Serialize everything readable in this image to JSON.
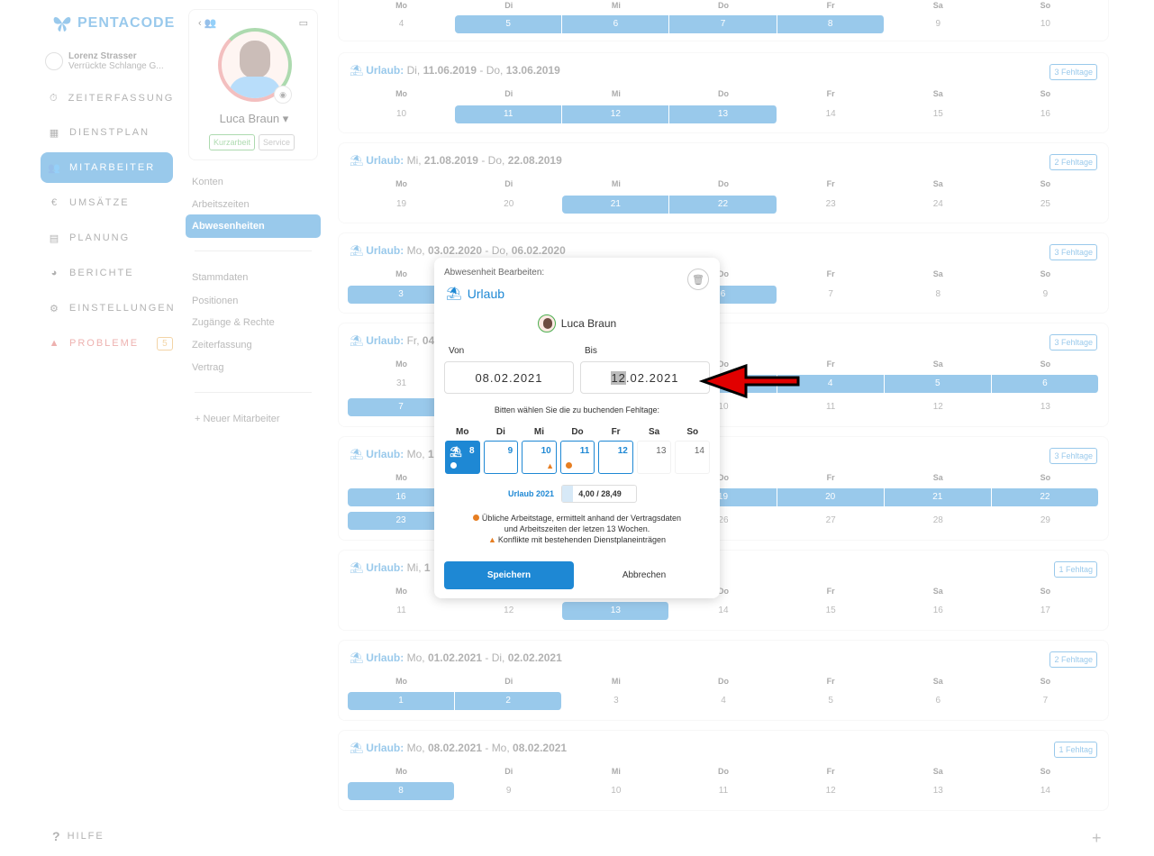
{
  "app": {
    "logo": "PENTACODE"
  },
  "user": {
    "name": "Lorenz Strasser",
    "company": "Verrückte Schlange G..."
  },
  "nav": {
    "items": [
      {
        "label": "ZEITERFASSUNG",
        "icon": "stopwatch-icon"
      },
      {
        "label": "DIENSTPLAN",
        "icon": "table-icon"
      },
      {
        "label": "MITARBEITER",
        "icon": "users-icon"
      },
      {
        "label": "UMSÄTZE",
        "icon": "euro-icon"
      },
      {
        "label": "PLANUNG",
        "icon": "calendar-icon"
      },
      {
        "label": "BERICHTE",
        "icon": "pie-chart-icon"
      },
      {
        "label": "EINSTELLUNGEN",
        "icon": "gear-icon"
      },
      {
        "label": "PROBLEME",
        "icon": "warning-icon",
        "badge": "5"
      }
    ],
    "active_index": 2,
    "help": "HILFE"
  },
  "profile": {
    "name": "Luca Braun",
    "tags": [
      "Kurzarbeit",
      "Service"
    ],
    "menu1": [
      "Konten",
      "Arbeitszeiten",
      "Abwesenheiten"
    ],
    "menu2": [
      "Stammdaten",
      "Positionen",
      "Zugänge & Rechte",
      "Zeiterfassung",
      "Vertrag"
    ],
    "new_employee": "Neuer Mitarbeiter"
  },
  "absences": [
    {
      "title": "",
      "badge": "",
      "weekdays": [
        "Mo",
        "Di",
        "Mi",
        "Do",
        "Fr",
        "Sa",
        "So"
      ],
      "rows": [
        [
          "4",
          "5",
          "6",
          "7",
          "8",
          "9",
          "10"
        ]
      ]
    },
    {
      "label": "Urlaub:",
      "from_day": "Di,",
      "from_date": "11.06.2019",
      "sep": "-",
      "to_day": "Do,",
      "to_date": "13.06.2019",
      "badge": "3 Fehltage",
      "weekdays": [
        "Mo",
        "Di",
        "Mi",
        "Do",
        "Fr",
        "Sa",
        "So"
      ],
      "rows": [
        [
          "10",
          "11",
          "12",
          "13",
          "14",
          "15",
          "16"
        ]
      ]
    },
    {
      "label": "Urlaub:",
      "from_day": "Mi,",
      "from_date": "21.08.2019",
      "sep": "-",
      "to_day": "Do,",
      "to_date": "22.08.2019",
      "badge": "2 Fehltage",
      "weekdays": [
        "Mo",
        "Di",
        "Mi",
        "Do",
        "Fr",
        "Sa",
        "So"
      ],
      "rows": [
        [
          "19",
          "20",
          "21",
          "22",
          "23",
          "24",
          "25"
        ]
      ]
    },
    {
      "label": "Urlaub:",
      "from_day": "Mo,",
      "from_date": "03.02.2020",
      "sep": "-",
      "to_day": "Do,",
      "to_date": "06.02.2020",
      "badge": "3 Fehltage",
      "weekdays": [
        "Mo",
        "Di",
        "Mi",
        "Do",
        "Fr",
        "Sa",
        "So"
      ],
      "rows": [
        [
          "3",
          "4",
          "5",
          "6",
          "7",
          "8",
          "9"
        ]
      ]
    },
    {
      "label": "Urlaub:",
      "from_day": "Fr,",
      "from_date": "04",
      "sep": "",
      "to_day": "",
      "to_date": "",
      "badge": "3 Fehltage",
      "weekdays": [
        "Mo",
        "Di",
        "Mi",
        "Do",
        "Fr",
        "Sa",
        "So"
      ],
      "rows": [
        [
          "31",
          "1",
          "2",
          "3",
          "4",
          "5",
          "6"
        ],
        [
          "7",
          "8",
          "9",
          "10",
          "11",
          "12",
          "13"
        ]
      ]
    },
    {
      "label": "Urlaub:",
      "from_day": "Mo,",
      "from_date": "1",
      "sep": "",
      "to_day": "",
      "to_date": "",
      "badge": "3 Fehltage",
      "weekdays": [
        "Mo",
        "Di",
        "Mi",
        "Do",
        "Fr",
        "Sa",
        "So"
      ],
      "rows": [
        [
          "16",
          "17",
          "18",
          "19",
          "20",
          "21",
          "22"
        ],
        [
          "23",
          "24",
          "25",
          "26",
          "27",
          "28",
          "29"
        ]
      ]
    },
    {
      "label": "Urlaub:",
      "from_day": "Mi,",
      "from_date": "1",
      "sep": "",
      "to_day": "",
      "to_date": "",
      "badge": "1 Fehltag",
      "weekdays": [
        "Mo",
        "Di",
        "Mi",
        "Do",
        "Fr",
        "Sa",
        "So"
      ],
      "rows": [
        [
          "11",
          "12",
          "13",
          "14",
          "15",
          "16",
          "17"
        ]
      ]
    },
    {
      "label": "Urlaub:",
      "from_day": "Mo,",
      "from_date": "01.02.2021",
      "sep": "-",
      "to_day": "Di,",
      "to_date": "02.02.2021",
      "badge": "2 Fehltage",
      "weekdays": [
        "Mo",
        "Di",
        "Mi",
        "Do",
        "Fr",
        "Sa",
        "So"
      ],
      "rows": [
        [
          "1",
          "2",
          "3",
          "4",
          "5",
          "6",
          "7"
        ]
      ]
    },
    {
      "label": "Urlaub:",
      "from_day": "Mo,",
      "from_date": "08.02.2021",
      "sep": "-",
      "to_day": "Mo,",
      "to_date": "08.02.2021",
      "badge": "1 Fehltag",
      "weekdays": [
        "Mo",
        "Di",
        "Mi",
        "Do",
        "Fr",
        "Sa",
        "So"
      ],
      "rows": [
        [
          "8",
          "9",
          "10",
          "11",
          "12",
          "13",
          "14"
        ]
      ]
    }
  ],
  "modal": {
    "header": "Abwesenheit Bearbeiten:",
    "type": "Urlaub",
    "employee": "Luca Braun",
    "from_label": "Von",
    "to_label": "Bis",
    "from_value": "08.02.2021",
    "to_value_sel": "12",
    "to_value_rest": ".02.2021",
    "prompt": "Bitten wählen Sie die zu buchenden Fehltage:",
    "weekdays": [
      "Mo",
      "Di",
      "Mi",
      "Do",
      "Fr",
      "Sa",
      "So"
    ],
    "days": [
      "8",
      "9",
      "10",
      "11",
      "12",
      "13",
      "14"
    ],
    "quota_label": "Urlaub 2021",
    "quota_value": "4,00 / 28,49",
    "quota_fraction": 0.14,
    "legend_line1": "Übliche Arbeitstage, ermittelt anhand der Vertragsdaten",
    "legend_line2": "und Arbeitszeiten der letzen 13 Wochen.",
    "legend_line3": "Konflikte mit bestehenden Dienstplaneinträgen",
    "save": "Speichern",
    "cancel": "Abbrechen"
  },
  "colors": {
    "accent": "#1e88d4",
    "warning": "#e67e22",
    "success": "#4caf50",
    "danger": "#d9534f"
  }
}
